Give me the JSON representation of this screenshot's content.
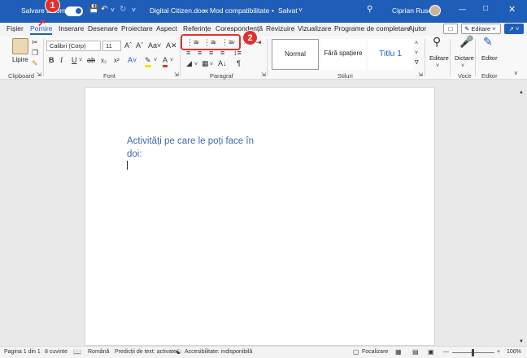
{
  "titlebar": {
    "autosave_label": "Salvare automată",
    "doc_title": "Digital Citizen.docx",
    "separator1": "•",
    "compat_mode": "Mod compatibilitate",
    "separator2": "•",
    "saved_status": "Salvat",
    "user_name": "Ciprian Rusen",
    "colors": {
      "bar": "#1f5eb8",
      "accent": "#e03131"
    }
  },
  "menu": {
    "tabs": [
      "Fișier",
      "Pornire",
      "Inserare",
      "Desenare",
      "Proiectare",
      "Aspect",
      "Referințe",
      "Corespondență",
      "Revizuire",
      "Vizualizare",
      "Programe de completare",
      "Ajutor"
    ],
    "active_tab": "Pornire",
    "comments_label": "",
    "editing_label": "Editare",
    "share_label": ""
  },
  "ribbon": {
    "clipboard": {
      "paste_label": "Lipire",
      "group_label": "Clipboard"
    },
    "font": {
      "font_name": "Calibri (Corp)",
      "font_size": "11",
      "group_label": "Font"
    },
    "paragraph": {
      "group_label": "Paragraf"
    },
    "styles": {
      "items": [
        "Normal",
        "Fără spațiere",
        "Titlu 1"
      ],
      "group_label": "Stiluri"
    },
    "editing": {
      "label": "Editare"
    },
    "voice": {
      "dictate_label": "Dictare",
      "group_label": "Voce"
    },
    "editor": {
      "label": "Editor",
      "group_label": "Editor"
    }
  },
  "annotations": {
    "badge1": "1",
    "badge2": "2"
  },
  "document": {
    "line1": "Activități pe care le poți face în",
    "line2": "doi:"
  },
  "status": {
    "page": "Pagina 1 din 1",
    "words": "8 cuvinte",
    "language": "Română",
    "prediction": "Predicții de text: activate",
    "accessibility": "Accesibilitate: indisponibilă",
    "focus": "Focalizare",
    "zoom": "100%"
  }
}
